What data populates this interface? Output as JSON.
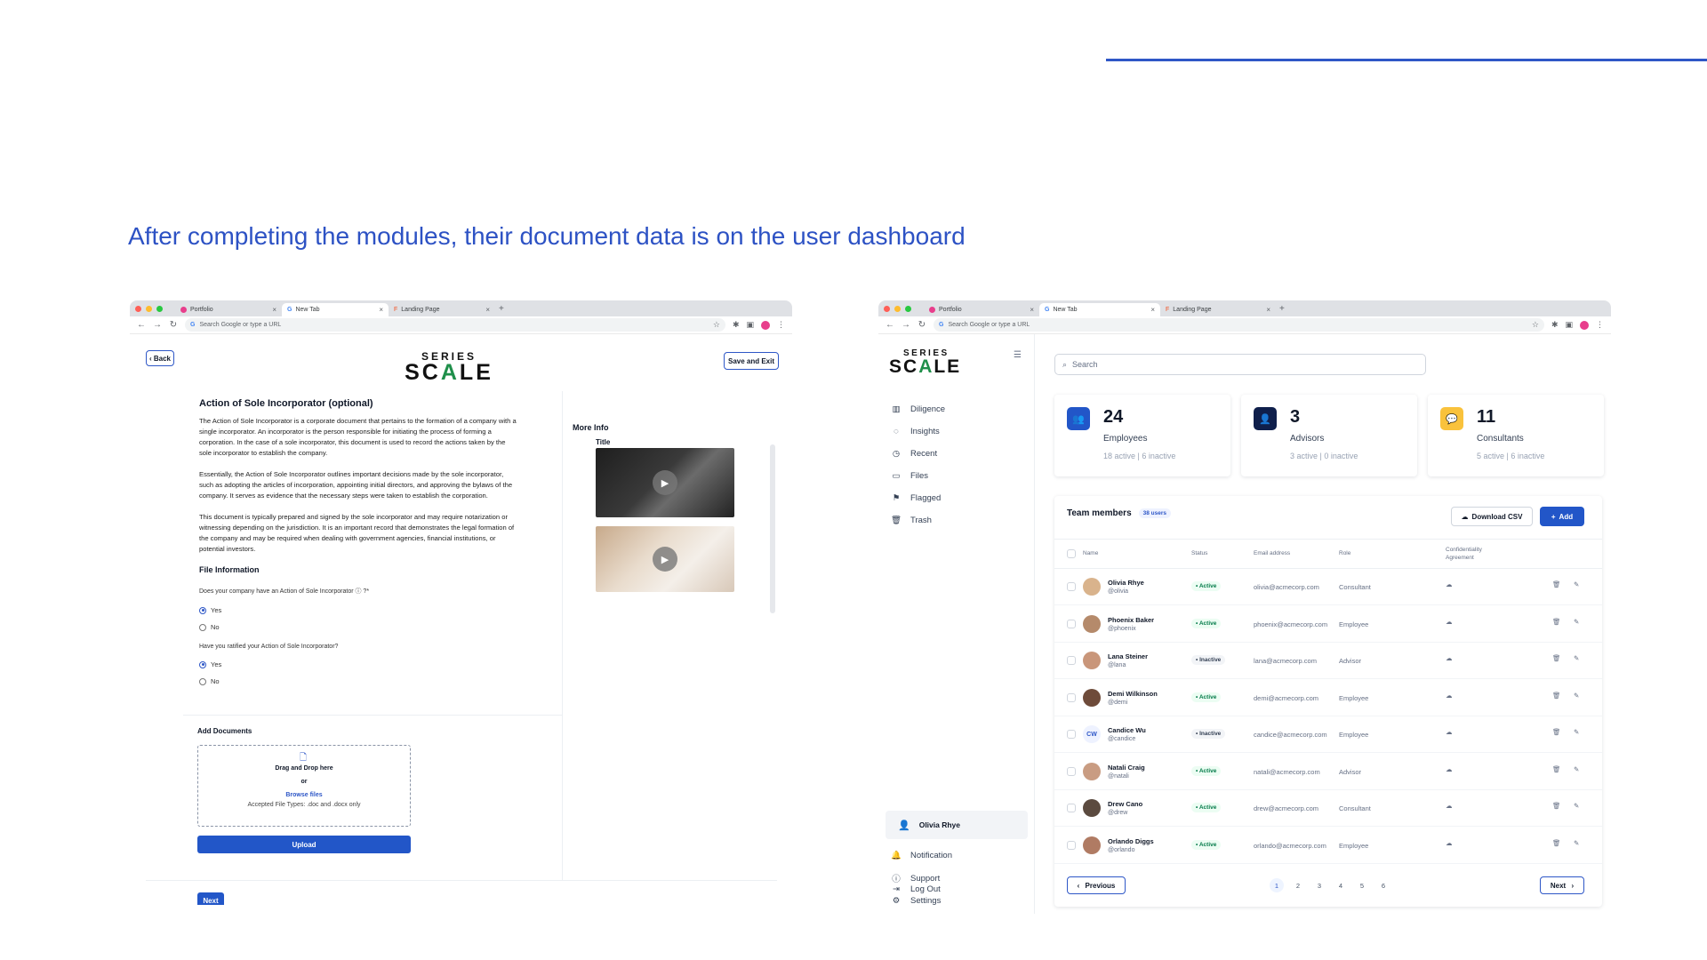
{
  "headline": "After completing the modules, their document data is on the user dashboard",
  "browser": {
    "tabs": [
      "Portfolio",
      "New Tab",
      "Landing Page"
    ],
    "omnibox_placeholder": "Search Google or type a URL"
  },
  "logo": {
    "series": "SERIES",
    "scale_pre": "SC",
    "scale_a": "A",
    "scale_post": "LE"
  },
  "form": {
    "back_label": "Back",
    "save_exit_label": "Save and Exit",
    "title": "Action of Sole Incorporator (optional)",
    "paragraphs": [
      "The Action of Sole Incorporator is a corporate document that pertains to the formation of a company with a single incorporator. An incorporator is the person responsible for initiating the process of forming a corporation. In the case of a sole incorporator, this document is used to record the actions taken by the sole incorporator to establish the company.",
      "Essentially, the Action of Sole Incorporator outlines important decisions made by the sole incorporator, such as adopting the articles of incorporation, appointing initial directors, and approving the bylaws of the company. It serves as evidence that the necessary steps were taken to establish the corporation.",
      "This document is typically prepared and signed by the sole incorporator and may require notarization or witnessing depending on the jurisdiction. It is an important record that demonstrates the legal formation of the company and may be required when dealing with government agencies, financial institutions, or potential investors."
    ],
    "file_info_heading": "File Information",
    "q1": "Does your company have an Action of Sole Incorporator ⓘ ?*",
    "q2": "Have you ratified your Action of Sole Incorporator?",
    "yes": "Yes",
    "no": "No",
    "add_docs": "Add Documents",
    "drag_drop": "Drag and Drop here",
    "or": "or",
    "browse": "Browse files",
    "accepted": "Accepted File Types: .doc and .docx only",
    "upload": "Upload",
    "next": "Next",
    "more_info": "More Info",
    "media_title": "Title"
  },
  "dashboard": {
    "search_placeholder": "Search",
    "nav": [
      "Diligence",
      "Insights",
      "Recent",
      "Files",
      "Flagged",
      "Trash"
    ],
    "user_name": "Olivia Rhye",
    "bottom_nav": [
      "Notification",
      "Support",
      "Settings",
      "Log Out"
    ],
    "stats": [
      {
        "num": "24",
        "label": "Employees",
        "active": "18 active",
        "inactive": "6 inactive",
        "color": "#2256c8"
      },
      {
        "num": "3",
        "label": "Advisors",
        "active": "3 active",
        "inactive": "0 inactive",
        "color": "#0f1f4b"
      },
      {
        "num": "11",
        "label": "Consultants",
        "active": "5 active",
        "inactive": "6 inactive",
        "color": "#f9c23c"
      }
    ],
    "team_title": "Team members",
    "team_count": "38 users",
    "download_csv": "Download CSV",
    "add": "Add",
    "columns": [
      "Name",
      "Status",
      "Email address",
      "Role",
      "Confidentiality Agreement"
    ],
    "members": [
      {
        "name": "Olivia Rhye",
        "handle": "@olivia",
        "status": "Active",
        "email": "olivia@acmecorp.com",
        "role": "Consultant",
        "initials": ""
      },
      {
        "name": "Phoenix Baker",
        "handle": "@phoenix",
        "status": "Active",
        "email": "phoenix@acmecorp.com",
        "role": "Employee",
        "initials": ""
      },
      {
        "name": "Lana Steiner",
        "handle": "@lana",
        "status": "Inactive",
        "email": "lana@acmecorp.com",
        "role": "Advisor",
        "initials": ""
      },
      {
        "name": "Demi Wilkinson",
        "handle": "@demi",
        "status": "Active",
        "email": "demi@acmecorp.com",
        "role": "Employee",
        "initials": ""
      },
      {
        "name": "Candice Wu",
        "handle": "@candice",
        "status": "Inactive",
        "email": "candice@acmecorp.com",
        "role": "Employee",
        "initials": "CW"
      },
      {
        "name": "Natali Craig",
        "handle": "@natali",
        "status": "Active",
        "email": "natali@acmecorp.com",
        "role": "Advisor",
        "initials": ""
      },
      {
        "name": "Drew Cano",
        "handle": "@drew",
        "status": "Active",
        "email": "drew@acmecorp.com",
        "role": "Consultant",
        "initials": ""
      },
      {
        "name": "Orlando Diggs",
        "handle": "@orlando",
        "status": "Active",
        "email": "orlando@acmecorp.com",
        "role": "Employee",
        "initials": ""
      }
    ],
    "previous": "Previous",
    "next": "Next",
    "pages": [
      "1",
      "2",
      "3",
      "4",
      "5",
      "6"
    ],
    "current_page": "1"
  }
}
